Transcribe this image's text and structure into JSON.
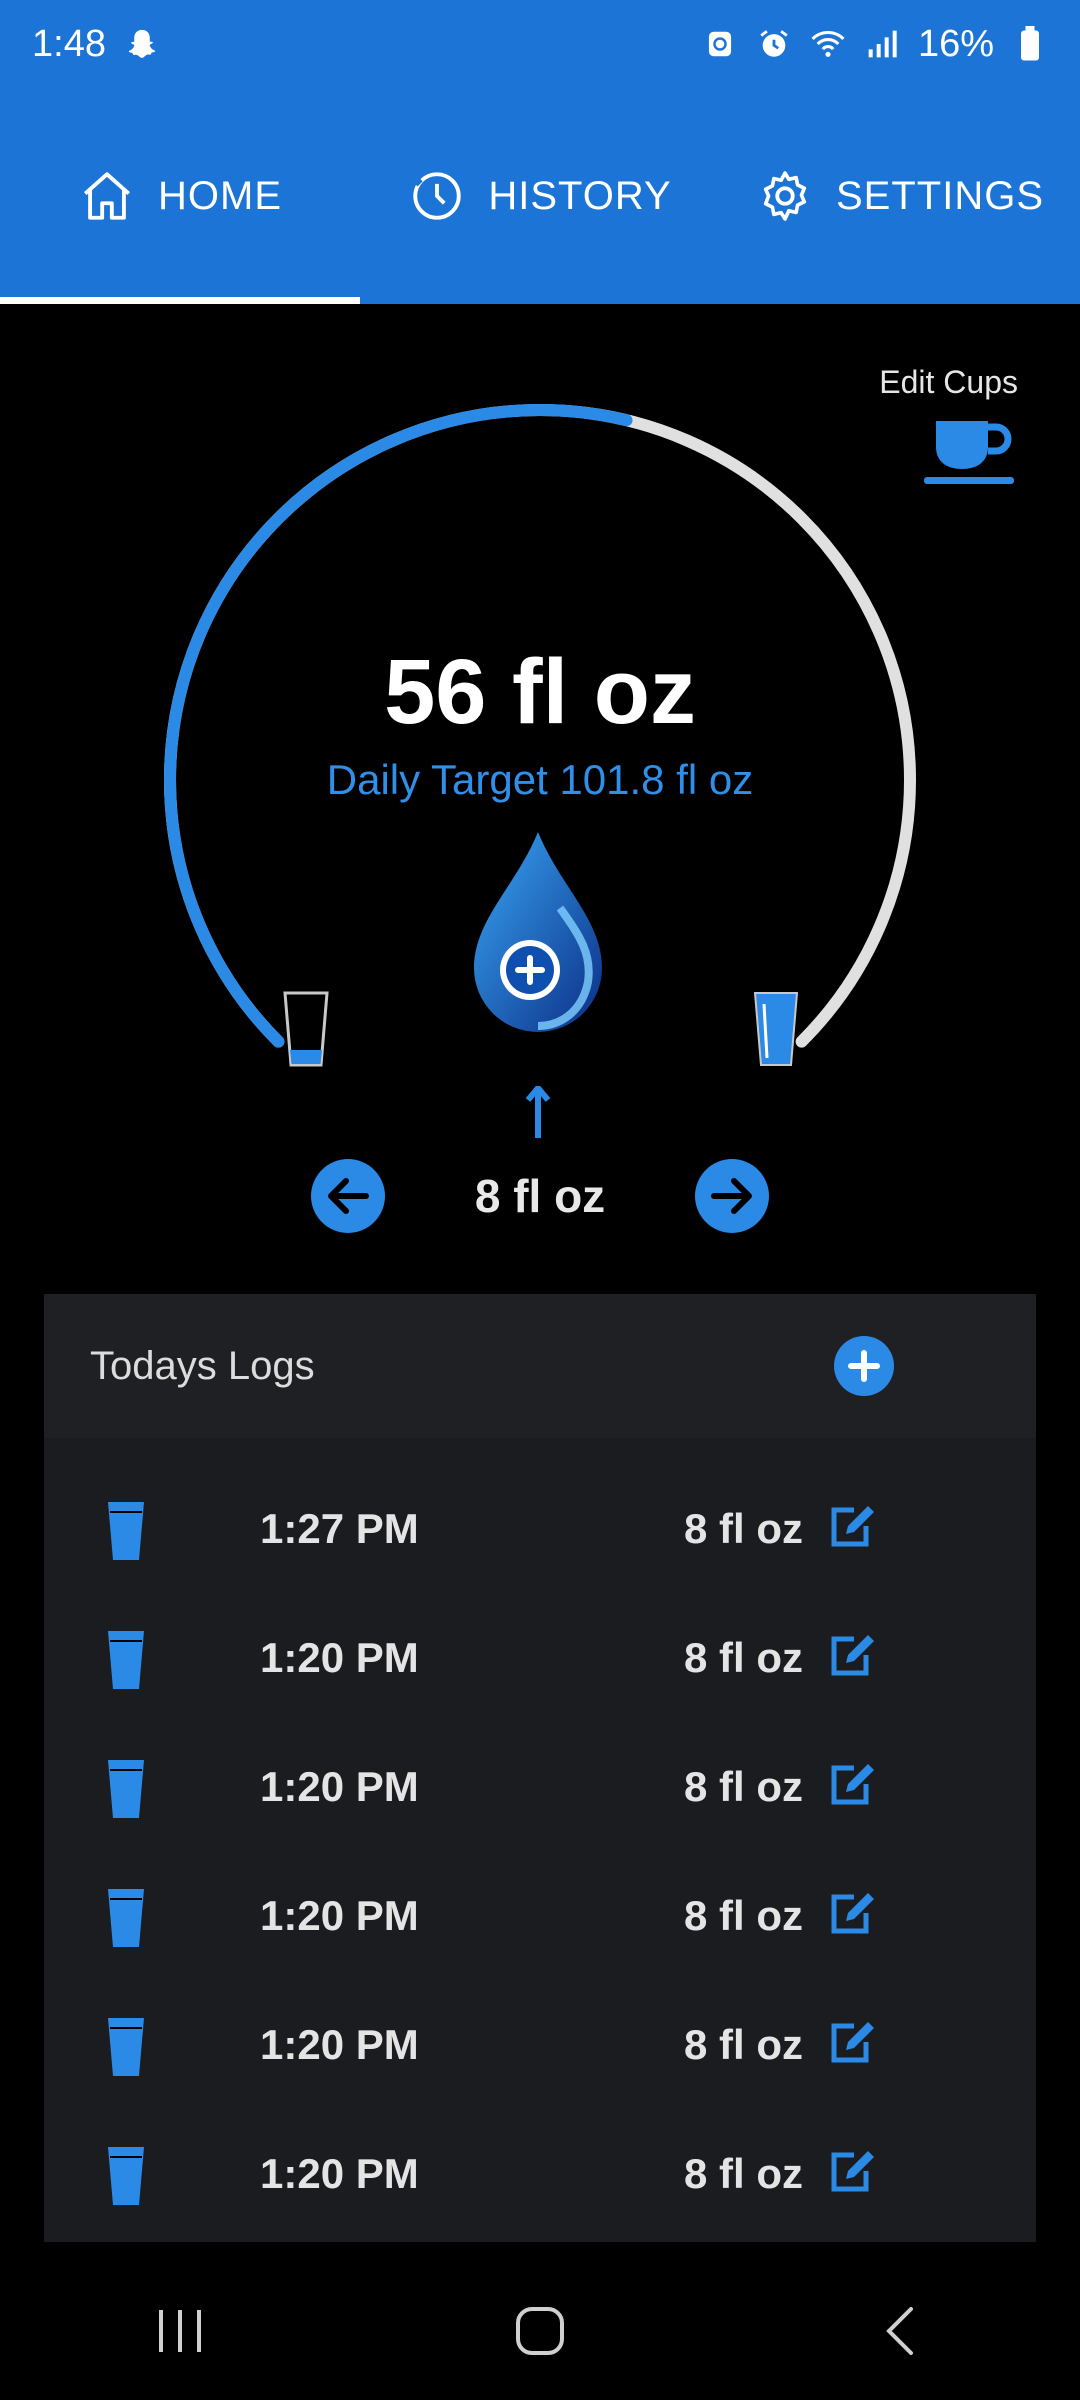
{
  "status_bar": {
    "time": "1:48",
    "battery": "16%",
    "icons": [
      "snapchat-ghost-icon",
      "recycle-icon",
      "alarm-icon",
      "wifi-icon",
      "signal-icon",
      "battery-icon"
    ]
  },
  "tabs": [
    {
      "label": "HOME",
      "icon": "home-icon",
      "active": true
    },
    {
      "label": "HISTORY",
      "icon": "history-icon",
      "active": false
    },
    {
      "label": "SETTINGS",
      "icon": "gear-icon",
      "active": false
    }
  ],
  "edit_cups": {
    "label": "Edit Cups",
    "icon": "coffee-cup-icon"
  },
  "progress": {
    "consumed": "56 fl oz",
    "target_label": "Daily Target 101.8 fl oz",
    "consumed_value": 56,
    "target_value": 101.8
  },
  "cup_selector": {
    "selected": "8 fl oz"
  },
  "logs": {
    "title": "Todays Logs",
    "entries": [
      {
        "time": "1:27 PM",
        "amount": "8 fl oz"
      },
      {
        "time": "1:20 PM",
        "amount": "8 fl oz"
      },
      {
        "time": "1:20 PM",
        "amount": "8 fl oz"
      },
      {
        "time": "1:20 PM",
        "amount": "8 fl oz"
      },
      {
        "time": "1:20 PM",
        "amount": "8 fl oz"
      },
      {
        "time": "1:20 PM",
        "amount": "8 fl oz"
      }
    ]
  },
  "colors": {
    "primary": "#1c74d6",
    "accent": "#2b8ae6",
    "track": "#e0e0e0",
    "panel": "#1b1c1f"
  },
  "nav_bar": {
    "icons": [
      "recent-apps-icon",
      "home-button-icon",
      "back-icon"
    ]
  }
}
